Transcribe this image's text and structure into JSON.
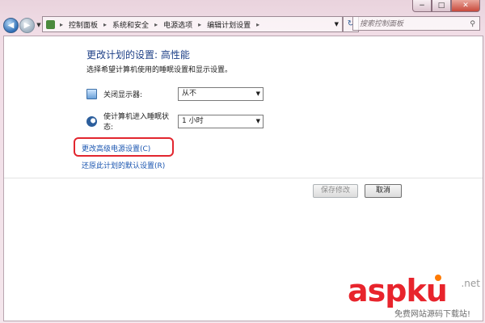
{
  "window": {
    "caption_buttons": [
      "−",
      "□",
      "✕"
    ]
  },
  "nav": {
    "back_glyph": "◀",
    "forward_glyph": "▶",
    "dropdown_glyph": "▼",
    "breadcrumb": [
      "控制面板",
      "系统和安全",
      "电源选项",
      "编辑计划设置"
    ],
    "breadcrumb_separator": "▸",
    "refresh_glyph": "↻",
    "search_placeholder": "搜索控制面板",
    "search_icon": "search-icon"
  },
  "main": {
    "title": "更改计划的设置: 高性能",
    "subtitle": "选择希望计算机使用的睡眠设置和显示设置。",
    "settings": [
      {
        "label": "关闭显示器:",
        "value": "从不",
        "icon": "monitor-icon"
      },
      {
        "label": "使计算机进入睡眠状态:",
        "value": "1 小时",
        "icon": "sleep-moon-icon"
      }
    ],
    "links": {
      "advanced": "更改高级电源设置(C)",
      "restore": "还原此计划的默认设置(R)"
    },
    "buttons": {
      "save": "保存修改",
      "cancel": "取消"
    }
  },
  "watermark": {
    "brand": "asp",
    "brand_suffix": "ku",
    "tld": ".net",
    "tagline": "免费网站源码下载站!"
  },
  "colors": {
    "title": "#1c3f86",
    "link": "#1a55b0",
    "highlight_box": "#e2262f",
    "watermark": "#e8242c"
  }
}
